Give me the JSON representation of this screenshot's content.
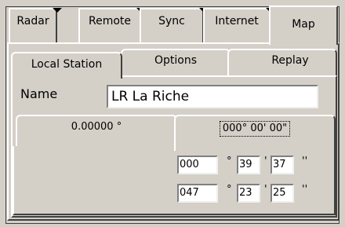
{
  "tabs": {
    "radar": "Radar",
    "remote": "Remote",
    "sync": "Sync",
    "internet": "Internet",
    "map": "Map"
  },
  "subtabs": {
    "local_station": "Local Station",
    "options": "Options",
    "replay": "Replay"
  },
  "name": {
    "label": "Name",
    "value": "LR La Riche"
  },
  "coord_tabs": {
    "decimal": "0.00000 °",
    "dms": "000° 00' 00\""
  },
  "coordinates": {
    "row1": {
      "deg": "000",
      "min": "39",
      "sec": "37"
    },
    "row2": {
      "deg": "047",
      "min": "23",
      "sec": "25"
    },
    "deg_symbol": "°",
    "min_symbol": "'",
    "sec_symbol": "''"
  }
}
